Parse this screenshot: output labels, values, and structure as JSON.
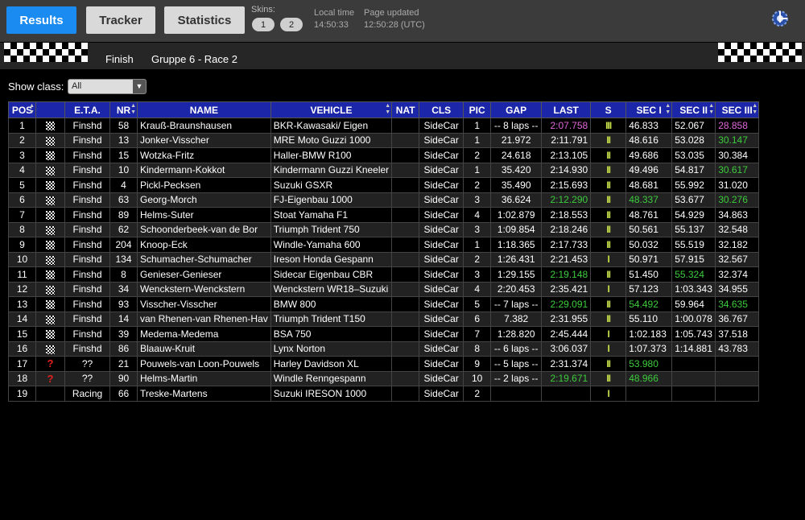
{
  "topbar": {
    "buttons": {
      "results": "Results",
      "tracker": "Tracker",
      "statistics": "Statistics"
    },
    "skins_label": "Skins:",
    "skins": [
      "1",
      "2"
    ],
    "local_time_label": "Local time",
    "local_time": "14:50:33",
    "page_updated_label": "Page updated",
    "page_updated": "12:50:28 (UTC)"
  },
  "session": {
    "status": "Finish",
    "title": "Gruppe 6 - Race 2"
  },
  "filter": {
    "label": "Show class:",
    "value": "All"
  },
  "colors": {
    "accent": "#1a8bf0",
    "header": "#1c26a8",
    "best_overall": "#e066d8",
    "personal_best": "#3ccc3c"
  },
  "table": {
    "columns": [
      "POS",
      "",
      "E.T.A.",
      "NR",
      "NAME",
      "VEHICLE",
      "NAT",
      "CLS",
      "PIC",
      "GAP",
      "LAST",
      "S",
      "SEC I",
      "SEC II",
      "SEC III"
    ],
    "rows": [
      {
        "pos": "1",
        "icon": "flag",
        "eta": "Finshd",
        "nr": "58",
        "name": "Krauß-Braunshausen",
        "vehicle": "BKR-Kawasaki/ Eigen",
        "nat": "",
        "cls": "SideCar",
        "pic": "1",
        "gap": "-- 8 laps --",
        "last": "2:07.758",
        "last_c": "purple",
        "s": "III",
        "sec1": "46.833",
        "sec1_c": "",
        "sec2": "52.067",
        "sec2_c": "",
        "sec3": "28.858",
        "sec3_c": "purple"
      },
      {
        "pos": "2",
        "icon": "flag",
        "eta": "Finshd",
        "nr": "13",
        "name": "Jonker-Visscher",
        "vehicle": "MRE Moto Guzzi 1000",
        "nat": "",
        "cls": "SideCar",
        "pic": "1",
        "gap": "21.972",
        "last": "2:11.791",
        "last_c": "",
        "s": "II",
        "sec1": "48.616",
        "sec1_c": "",
        "sec2": "53.028",
        "sec2_c": "",
        "sec3": "30.147",
        "sec3_c": "green"
      },
      {
        "pos": "3",
        "icon": "flag",
        "eta": "Finshd",
        "nr": "15",
        "name": "Wotzka-Fritz",
        "vehicle": "Haller-BMW R100",
        "nat": "",
        "cls": "SideCar",
        "pic": "2",
        "gap": "24.618",
        "last": "2:13.105",
        "last_c": "",
        "s": "II",
        "sec1": "49.686",
        "sec1_c": "",
        "sec2": "53.035",
        "sec2_c": "",
        "sec3": "30.384",
        "sec3_c": ""
      },
      {
        "pos": "4",
        "icon": "flag",
        "eta": "Finshd",
        "nr": "10",
        "name": "Kindermann-Kokkot",
        "vehicle": "Kindermann Guzzi Kneeler",
        "nat": "",
        "cls": "SideCar",
        "pic": "1",
        "gap": "35.420",
        "last": "2:14.930",
        "last_c": "",
        "s": "II",
        "sec1": "49.496",
        "sec1_c": "",
        "sec2": "54.817",
        "sec2_c": "",
        "sec3": "30.617",
        "sec3_c": "green"
      },
      {
        "pos": "5",
        "icon": "flag",
        "eta": "Finshd",
        "nr": "4",
        "name": "Pickl-Pecksen",
        "vehicle": "Suzuki GSXR",
        "nat": "",
        "cls": "SideCar",
        "pic": "2",
        "gap": "35.490",
        "last": "2:15.693",
        "last_c": "",
        "s": "II",
        "sec1": "48.681",
        "sec1_c": "",
        "sec2": "55.992",
        "sec2_c": "",
        "sec3": "31.020",
        "sec3_c": ""
      },
      {
        "pos": "6",
        "icon": "flag",
        "eta": "Finshd",
        "nr": "63",
        "name": "Georg-Morch",
        "vehicle": "FJ-Eigenbau 1000",
        "nat": "",
        "cls": "SideCar",
        "pic": "3",
        "gap": "36.624",
        "last": "2:12.290",
        "last_c": "green",
        "s": "II",
        "sec1": "48.337",
        "sec1_c": "green",
        "sec2": "53.677",
        "sec2_c": "",
        "sec3": "30.276",
        "sec3_c": "green"
      },
      {
        "pos": "7",
        "icon": "flag",
        "eta": "Finshd",
        "nr": "89",
        "name": "Helms-Suter",
        "vehicle": "Stoat Yamaha F1",
        "nat": "",
        "cls": "SideCar",
        "pic": "4",
        "gap": "1:02.879",
        "last": "2:18.553",
        "last_c": "",
        "s": "II",
        "sec1": "48.761",
        "sec1_c": "",
        "sec2": "54.929",
        "sec2_c": "",
        "sec3": "34.863",
        "sec3_c": ""
      },
      {
        "pos": "8",
        "icon": "flag",
        "eta": "Finshd",
        "nr": "62",
        "name": "Schoonderbeek-van de Bor",
        "vehicle": "Triumph Trident 750",
        "nat": "",
        "cls": "SideCar",
        "pic": "3",
        "gap": "1:09.854",
        "last": "2:18.246",
        "last_c": "",
        "s": "II",
        "sec1": "50.561",
        "sec1_c": "",
        "sec2": "55.137",
        "sec2_c": "",
        "sec3": "32.548",
        "sec3_c": ""
      },
      {
        "pos": "9",
        "icon": "flag",
        "eta": "Finshd",
        "nr": "204",
        "name": "Knoop-Eck",
        "vehicle": "Windle-Yamaha 600",
        "nat": "",
        "cls": "SideCar",
        "pic": "1",
        "gap": "1:18.365",
        "last": "2:17.733",
        "last_c": "",
        "s": "II",
        "sec1": "50.032",
        "sec1_c": "",
        "sec2": "55.519",
        "sec2_c": "",
        "sec3": "32.182",
        "sec3_c": ""
      },
      {
        "pos": "10",
        "icon": "flag",
        "eta": "Finshd",
        "nr": "134",
        "name": "Schumacher-Schumacher",
        "vehicle": "Ireson Honda Gespann",
        "nat": "",
        "cls": "SideCar",
        "pic": "2",
        "gap": "1:26.431",
        "last": "2:21.453",
        "last_c": "",
        "s": "I",
        "sec1": "50.971",
        "sec1_c": "",
        "sec2": "57.915",
        "sec2_c": "",
        "sec3": "32.567",
        "sec3_c": ""
      },
      {
        "pos": "11",
        "icon": "flag",
        "eta": "Finshd",
        "nr": "8",
        "name": "Genieser-Genieser",
        "vehicle": "Sidecar Eigenbau CBR",
        "nat": "",
        "cls": "SideCar",
        "pic": "3",
        "gap": "1:29.155",
        "last": "2:19.148",
        "last_c": "green",
        "s": "II",
        "sec1": "51.450",
        "sec1_c": "",
        "sec2": "55.324",
        "sec2_c": "green",
        "sec3": "32.374",
        "sec3_c": ""
      },
      {
        "pos": "12",
        "icon": "flag",
        "eta": "Finshd",
        "nr": "34",
        "name": "Wenckstern-Wenckstern",
        "vehicle": "Wenckstern WR18–Suzuki",
        "nat": "",
        "cls": "SideCar",
        "pic": "4",
        "gap": "2:20.453",
        "last": "2:35.421",
        "last_c": "",
        "s": "I",
        "sec1": "57.123",
        "sec1_c": "",
        "sec2": "1:03.343",
        "sec2_c": "",
        "sec3": "34.955",
        "sec3_c": ""
      },
      {
        "pos": "13",
        "icon": "flag",
        "eta": "Finshd",
        "nr": "93",
        "name": "Visscher-Visscher",
        "vehicle": "BMW 800",
        "nat": "",
        "cls": "SideCar",
        "pic": "5",
        "gap": "-- 7 laps --",
        "last": "2:29.091",
        "last_c": "green",
        "s": "II",
        "sec1": "54.492",
        "sec1_c": "green",
        "sec2": "59.964",
        "sec2_c": "",
        "sec3": "34.635",
        "sec3_c": "green"
      },
      {
        "pos": "14",
        "icon": "flag",
        "eta": "Finshd",
        "nr": "14",
        "name": "van Rhenen-van Rhenen-Hav",
        "vehicle": "Triumph Trident T150",
        "nat": "",
        "cls": "SideCar",
        "pic": "6",
        "gap": "7.382",
        "last": "2:31.955",
        "last_c": "",
        "s": "II",
        "sec1": "55.110",
        "sec1_c": "",
        "sec2": "1:00.078",
        "sec2_c": "",
        "sec3": "36.767",
        "sec3_c": ""
      },
      {
        "pos": "15",
        "icon": "flag",
        "eta": "Finshd",
        "nr": "39",
        "name": "Medema-Medema",
        "vehicle": "BSA 750",
        "nat": "",
        "cls": "SideCar",
        "pic": "7",
        "gap": "1:28.820",
        "last": "2:45.444",
        "last_c": "",
        "s": "I",
        "sec1": "1:02.183",
        "sec1_c": "",
        "sec2": "1:05.743",
        "sec2_c": "",
        "sec3": "37.518",
        "sec3_c": ""
      },
      {
        "pos": "16",
        "icon": "flag",
        "eta": "Finshd",
        "nr": "86",
        "name": "Blaauw-Kruit",
        "vehicle": "Lynx Norton",
        "nat": "",
        "cls": "SideCar",
        "pic": "8",
        "gap": "-- 6 laps --",
        "last": "3:06.037",
        "last_c": "",
        "s": "I",
        "sec1": "1:07.373",
        "sec1_c": "",
        "sec2": "1:14.881",
        "sec2_c": "",
        "sec3": "43.783",
        "sec3_c": ""
      },
      {
        "pos": "17",
        "icon": "question",
        "eta": "??",
        "nr": "21",
        "name": "Pouwels-van Loon-Pouwels",
        "vehicle": "Harley Davidson XL",
        "nat": "",
        "cls": "SideCar",
        "pic": "9",
        "gap": "-- 5 laps --",
        "last": "2:31.374",
        "last_c": "",
        "s": "II",
        "sec1": "53.980",
        "sec1_c": "green",
        "sec2": "",
        "sec2_c": "",
        "sec3": "",
        "sec3_c": ""
      },
      {
        "pos": "18",
        "icon": "question",
        "eta": "??",
        "nr": "90",
        "name": "Helms-Martin",
        "vehicle": "Windle Renngespann",
        "nat": "",
        "cls": "SideCar",
        "pic": "10",
        "gap": "-- 2 laps --",
        "last": "2:19.671",
        "last_c": "green",
        "s": "II",
        "sec1": "48.966",
        "sec1_c": "green",
        "sec2": "",
        "sec2_c": "",
        "sec3": "",
        "sec3_c": ""
      },
      {
        "pos": "19",
        "icon": "",
        "eta": "Racing",
        "nr": "66",
        "name": "Treske-Martens",
        "vehicle": "Suzuki IRESON 1000",
        "nat": "",
        "cls": "SideCar",
        "pic": "2",
        "gap": "",
        "last": "",
        "last_c": "",
        "s": "I",
        "sec1": "",
        "sec1_c": "",
        "sec2": "",
        "sec2_c": "",
        "sec3": "",
        "sec3_c": ""
      }
    ]
  }
}
